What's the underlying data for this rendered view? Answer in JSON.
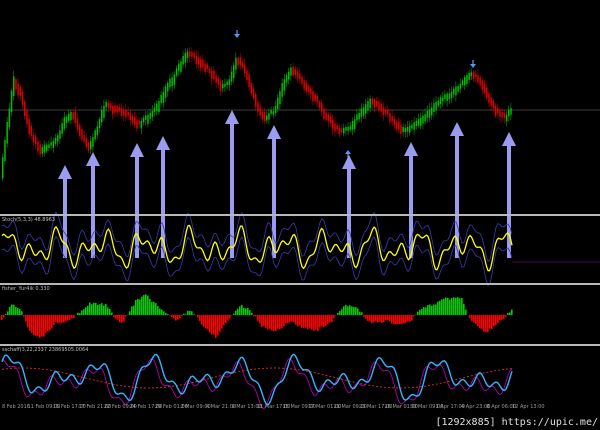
{
  "panes": {
    "stoch": {
      "label": "Stoch(5,3,3) 48.8963"
    },
    "fisher": {
      "label": "fisher_Yur4ik 0.330"
    },
    "schaff": {
      "label": "sschaff(3,22,2337 23869505.0064"
    }
  },
  "xaxis": {
    "labels": [
      "8 Feb 2016",
      "11 Feb 09:00",
      "15 Feb 17:00",
      "17 Feb 21:00",
      "22 Feb 09:00",
      "24 Feb 17:00",
      "29 Feb 01:00",
      "2 Mar 09:00",
      "4 Mar 21:00",
      "9 Mar 13:00",
      "11 Mar 17:00",
      "15 Mar 09:00",
      "17 Mar 01:00",
      "21 Mar 09:00",
      "23 Mar 17:00",
      "28 Mar 01:00",
      "30 Mar 09:00",
      "1 Apr 17:00",
      "4 Apr 23:00",
      "8 Apr 06:00",
      "12 Apr 13:00"
    ]
  },
  "watermark": "[1292x885] https://upic.me/",
  "colors": {
    "background": "#000000",
    "bull_candle": "#00c000",
    "bear_candle": "#e00000",
    "signal_arrow": "#9a9cf0",
    "stoch_main": "#ffff00",
    "stoch_band": "#3a3ab0",
    "fisher_pos": "#00d000",
    "fisher_neg": "#ff0000",
    "schaff_line": "#33b5ff",
    "schaff_signal": "#ff3333",
    "schaff_aux": "#c000c0",
    "separator": "#b8b8b8"
  }
}
